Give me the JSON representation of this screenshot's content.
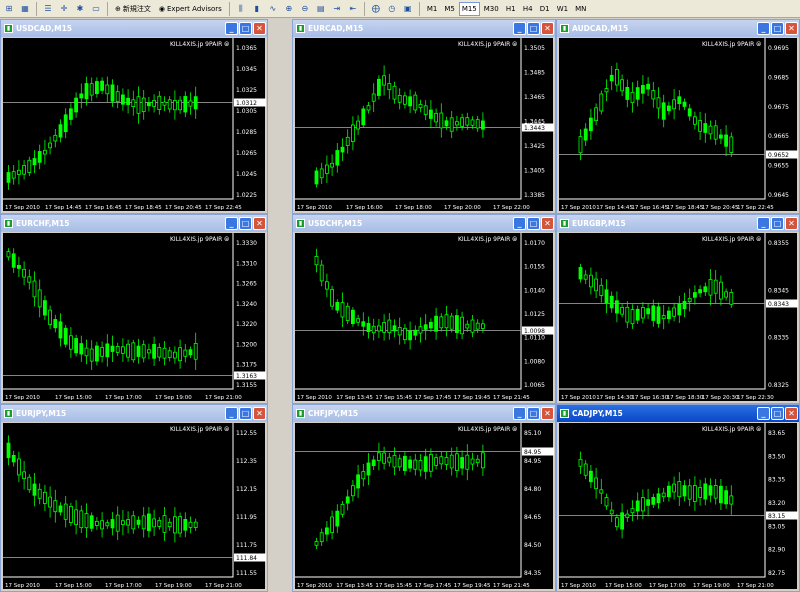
{
  "toolbar": {
    "buttons": [
      "new-chart-icon",
      "profiles-icon",
      "market-watch-icon",
      "crosshair-icon",
      "zoom-icon",
      "navigator-icon",
      "history-icon"
    ],
    "new_order_label": "新規注文",
    "expert_label": "Expert Advisors",
    "timeframes": [
      "M1",
      "M5",
      "M15",
      "M30",
      "H1",
      "H4",
      "D1",
      "W1",
      "MN"
    ],
    "active_timeframe": "M15"
  },
  "colors": {
    "candle": "#00ff00",
    "bg": "#000000",
    "grid": "#ffffff"
  },
  "windows": [
    {
      "title": "USDCAD,M15",
      "brand": "KILL4XIS.jp 9PAIR ⦾",
      "active": false,
      "price_label": "1.0312",
      "y_ticks": [
        "1.0365",
        "1.0345",
        "1.0325",
        "1.0305",
        "1.0285",
        "1.0265",
        "1.0245",
        "1.0225"
      ],
      "x_ticks": [
        "17 Sep 2010",
        "17 Sep 14:45",
        "17 Sep 16:45",
        "17 Sep 18:45",
        "17 Sep 20:45",
        "17 Sep 22:45"
      ]
    },
    {
      "title": "EURCAD,M15",
      "brand": "KILL4XIS.jp 9PAIR ⦾",
      "active": false,
      "price_label": "1.3443",
      "y_ticks": [
        "1.3505",
        "1.3485",
        "1.3465",
        "1.3445",
        "1.3425",
        "1.3405",
        "1.3385"
      ],
      "x_ticks": [
        "17 Sep 2010",
        "17 Sep 16:00",
        "17 Sep 18:00",
        "17 Sep 20:00",
        "17 Sep 22:00"
      ]
    },
    {
      "title": "AUDCAD,M15",
      "brand": "KILL4XIS.jp 9PAIR ⦾",
      "active": false,
      "price_label": "0.9652",
      "y_ticks": [
        "0.9695",
        "0.9685",
        "0.9675",
        "0.9665",
        "0.9655",
        "0.9645"
      ],
      "x_ticks": [
        "17 Sep 2010",
        "17 Sep 14:45",
        "17 Sep 16:45",
        "17 Sep 18:45",
        "17 Sep 20:45",
        "17 Sep 22:45"
      ]
    },
    {
      "title": "EURCHF,M15",
      "brand": "KILL4XIS.jp 9PAIR ⦾",
      "active": false,
      "price_label": "1.3163",
      "y_ticks": [
        "1.3330",
        "1.3310",
        "1.3265",
        "1.3240",
        "1.3220",
        "1.3200",
        "1.3175",
        "1.3155"
      ],
      "x_ticks": [
        "17 Sep 2010",
        "17 Sep 15:00",
        "17 Sep 17:00",
        "17 Sep 19:00",
        "17 Sep 21:00"
      ]
    },
    {
      "title": "USDCHF,M15",
      "brand": "KILL4XIS.jp 9PAIR ⦾",
      "active": false,
      "price_label": "1.0098",
      "y_ticks": [
        "1.0170",
        "1.0155",
        "1.0140",
        "1.0125",
        "1.0110",
        "1.0080",
        "1.0065"
      ],
      "x_ticks": [
        "17 Sep 2010",
        "17 Sep 13:45",
        "17 Sep 15:45",
        "17 Sep 17:45",
        "17 Sep 19:45",
        "17 Sep 21:45"
      ]
    },
    {
      "title": "EURGBP,M15",
      "brand": "KILL4XIS.jp 9PAIR ⦾",
      "active": false,
      "price_label": "0.8343",
      "y_ticks": [
        "0.8355",
        "0.8345",
        "0.8335",
        "0.8325"
      ],
      "x_ticks": [
        "17 Sep 2010",
        "17 Sep 14:30",
        "17 Sep 16:30",
        "17 Sep 18:30",
        "17 Sep 20:30",
        "17 Sep 22:30"
      ]
    },
    {
      "title": "EURJPY,M15",
      "brand": "KILL4XIS.jp 9PAIR ⦾",
      "active": false,
      "price_label": "111.84",
      "y_ticks": [
        "112.55",
        "112.35",
        "112.15",
        "111.95",
        "111.75",
        "111.55"
      ],
      "x_ticks": [
        "17 Sep 2010",
        "17 Sep 15:00",
        "17 Sep 17:00",
        "17 Sep 19:00",
        "17 Sep 21:00"
      ]
    },
    {
      "title": "CHFJPY,M15",
      "brand": "KILL4XIS.jp 9PAIR ⦾",
      "active": false,
      "price_label": "84.95",
      "y_ticks": [
        "85.10",
        "84.95",
        "84.80",
        "84.65",
        "84.50",
        "84.35"
      ],
      "x_ticks": [
        "17 Sep 2010",
        "17 Sep 13:45",
        "17 Sep 15:45",
        "17 Sep 17:45",
        "17 Sep 19:45",
        "17 Sep 21:45"
      ]
    },
    {
      "title": "CADJPY,M15",
      "brand": "KILL4XIS.jp 9PAIR ⦾",
      "active": true,
      "price_label": "83.15",
      "y_ticks": [
        "83.65",
        "83.50",
        "83.35",
        "83.20",
        "83.05",
        "82.90",
        "82.75"
      ],
      "x_ticks": [
        "17 Sep 2010",
        "17 Sep 15:00",
        "17 Sep 17:00",
        "17 Sep 19:00",
        "17 Sep 21:00"
      ]
    }
  ]
}
